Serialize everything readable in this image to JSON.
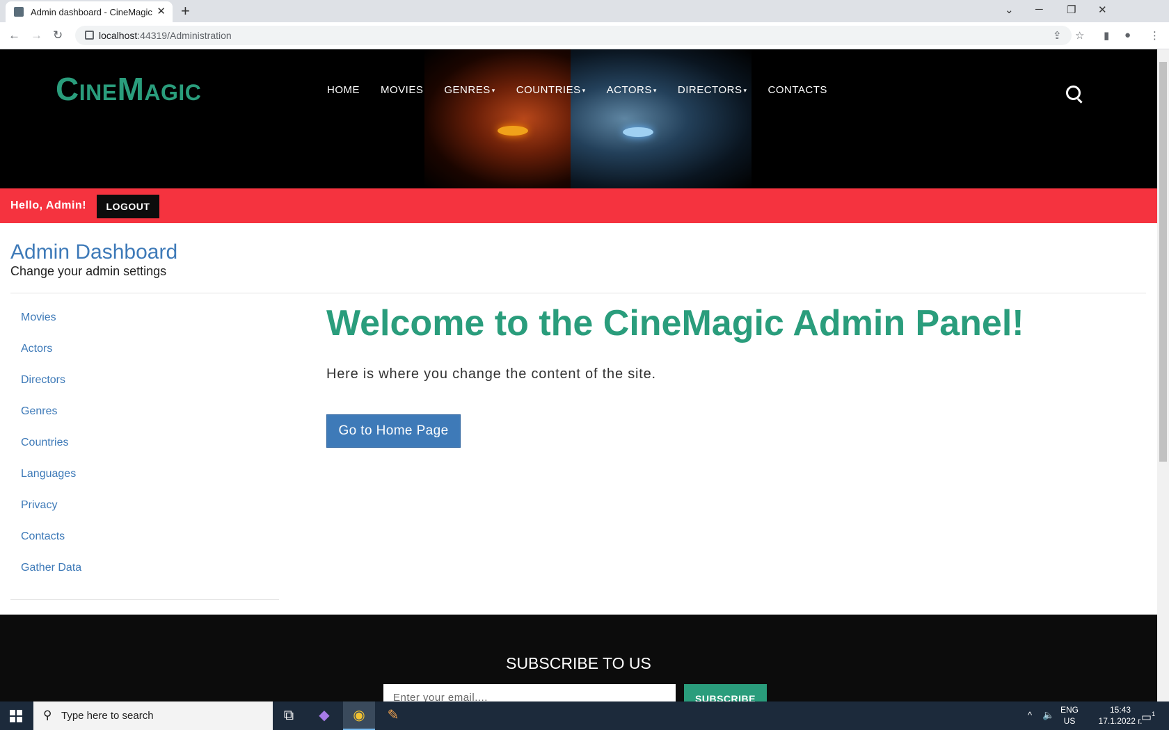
{
  "browser": {
    "tab_title": "Admin dashboard - CineMagic",
    "tab_close": "✕",
    "new_tab": "+",
    "url_host": "localhost",
    "url_path": ":44319/Administration"
  },
  "site": {
    "logo": {
      "c": "C",
      "ine": "INE",
      "m": "M",
      "agic": "AGIC"
    },
    "nav": [
      "HOME",
      "MOVIES",
      "GENRES",
      "COUNTRIES",
      "ACTORS",
      "DIRECTORS",
      "CONTACTS"
    ],
    "greeting": "Hello, Admin!",
    "logout_label": "LOGOUT"
  },
  "dashboard": {
    "title": "Admin Dashboard",
    "subtitle": "Change your admin settings",
    "sidebar": [
      "Movies",
      "Actors",
      "Directors",
      "Genres",
      "Countries",
      "Languages",
      "Privacy",
      "Contacts",
      "Gather Data"
    ],
    "welcome": "Welcome to the CineMagic Admin Panel!",
    "lead": "Here is where you change the content of the site.",
    "home_button": "Go to Home Page"
  },
  "footer": {
    "subscribe_title": "SUBSCRIBE TO US",
    "email_placeholder": "Enter your email....",
    "subscribe_button": "SUBSCRIBE"
  },
  "taskbar": {
    "search_placeholder": "Type here to search",
    "lang_1": "ENG",
    "lang_2": "US",
    "time": "15:43",
    "date": "17.1.2022 г.",
    "notif_count": "1"
  },
  "colors": {
    "accent_green": "#2a9d7c",
    "brand_red": "#f5333f",
    "link_blue": "#3e7ab8"
  }
}
